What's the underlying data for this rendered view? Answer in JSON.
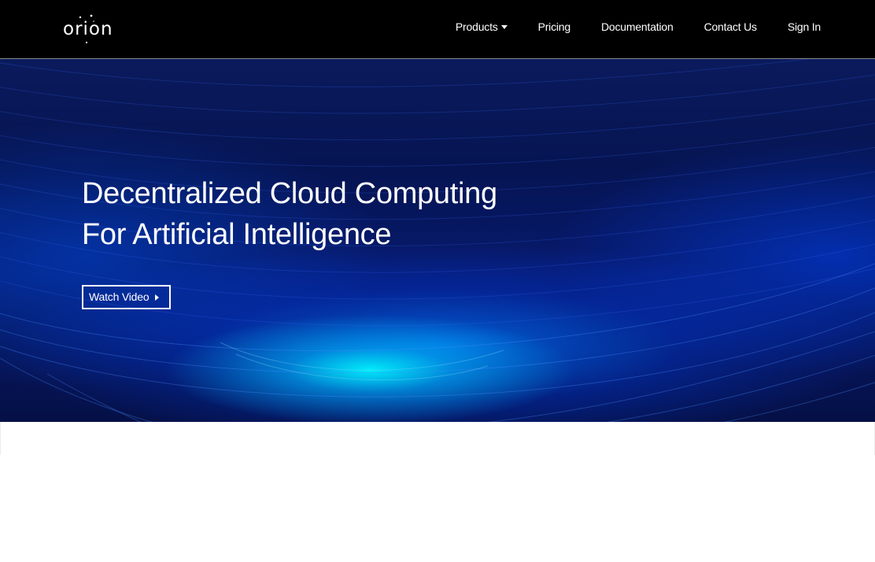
{
  "brand": {
    "logo_text": "orion",
    "logo_icon": "orion-constellation-logo"
  },
  "nav": {
    "items": [
      {
        "label": "Products",
        "has_dropdown": true,
        "icon": "caret-down-icon"
      },
      {
        "label": "Pricing"
      },
      {
        "label": "Documentation"
      },
      {
        "label": "Contact Us"
      },
      {
        "label": "Sign In"
      }
    ]
  },
  "hero": {
    "title_line1": "Decentralized Cloud Computing",
    "title_line2": "For Artificial Intelligence",
    "cta_label": "Watch Video",
    "cta_icon": "play-icon"
  },
  "colors": {
    "nav_background": "#000000",
    "hero_background": "#061452",
    "hero_glow": "#00f0ff",
    "text": "#ffffff",
    "page_background": "#ffffff"
  }
}
